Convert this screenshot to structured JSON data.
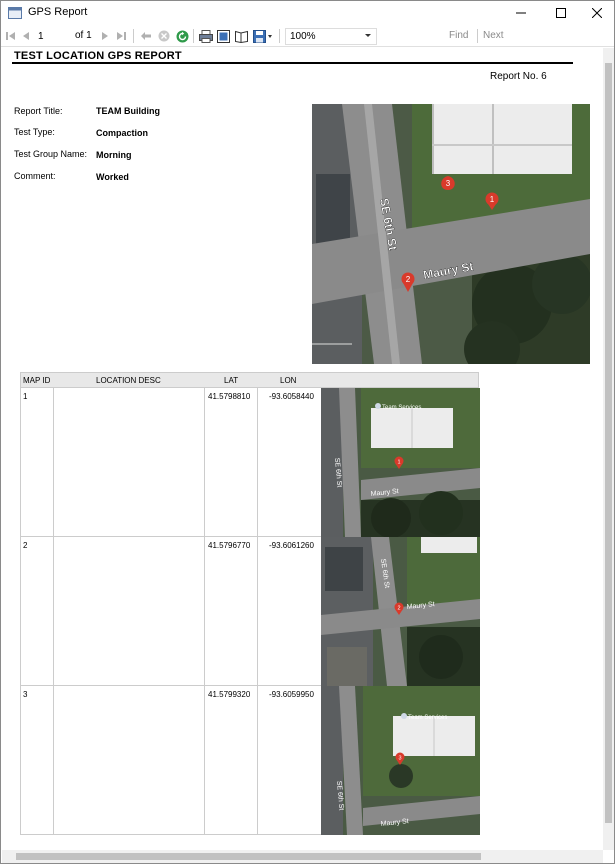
{
  "window": {
    "title": "GPS Report"
  },
  "toolbar": {
    "page_current": "1",
    "page_of": "of",
    "page_total": "1",
    "zoom": "100%",
    "find_label": "Find",
    "next_label": "Next"
  },
  "report": {
    "heading": "TEST LOCATION GPS REPORT",
    "report_no": "Report No. 6",
    "fields": [
      {
        "label": "Report Title:",
        "value": "TEAM Building"
      },
      {
        "label": "Test Type:",
        "value": "Compaction"
      },
      {
        "label": "Test Group Name:",
        "value": "Morning"
      },
      {
        "label": "Comment:",
        "value": "Worked"
      }
    ],
    "map": {
      "street_vertical": "SE 6th St",
      "street_horizontal": "Maury St",
      "markers": [
        "1",
        "2",
        "3"
      ]
    },
    "table": {
      "headers": [
        "MAP ID",
        "LOCATION DESC",
        "LAT",
        "LON"
      ],
      "rows": [
        {
          "id": "1",
          "desc": "",
          "lat": "41.5798810",
          "lon": "-93.6058440",
          "marker": "1",
          "business": "Team Services"
        },
        {
          "id": "2",
          "desc": "",
          "lat": "41.5796770",
          "lon": "-93.6061260",
          "marker": "2",
          "business": ""
        },
        {
          "id": "3",
          "desc": "",
          "lat": "41.5799320",
          "lon": "-93.6059950",
          "marker": "3",
          "business": "Team Services"
        }
      ],
      "row_map_street_vertical": "SE 6th St",
      "row_map_street_horizontal": "Maury St"
    }
  },
  "colors": {
    "marker": "#d93a2b",
    "grass": "#4d6a3b",
    "road": "#8f8f8f",
    "roof": "#ededed"
  }
}
